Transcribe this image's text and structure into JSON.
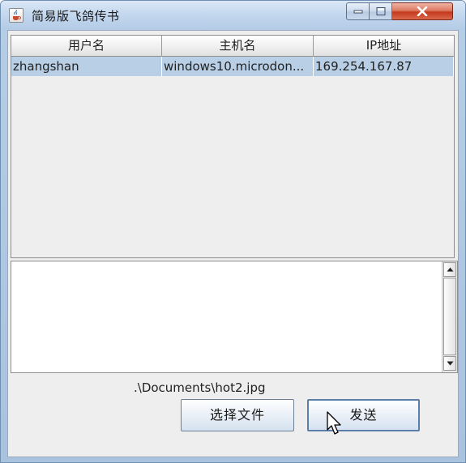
{
  "window": {
    "title": "简易版飞鸽传书",
    "title_icon": "java-cup-icon",
    "controls": [
      "minimize-icon",
      "maximize-icon",
      "close-icon"
    ]
  },
  "table": {
    "columns": [
      "用户名",
      "主机名",
      "IP地址"
    ],
    "rows": [
      [
        "zhangshan",
        "windows10.microdon...",
        "169.254.167.87"
      ]
    ],
    "selected_row": 0
  },
  "message": {
    "text": ""
  },
  "file": {
    "path": ".\\Documents\\hot2.jpg"
  },
  "buttons": {
    "choose_file": "选择文件",
    "send": "发送"
  },
  "colors": {
    "selected_row": "#b8cfe5",
    "panel_bg": "#eeeeee",
    "close_button": "#c5391e"
  }
}
